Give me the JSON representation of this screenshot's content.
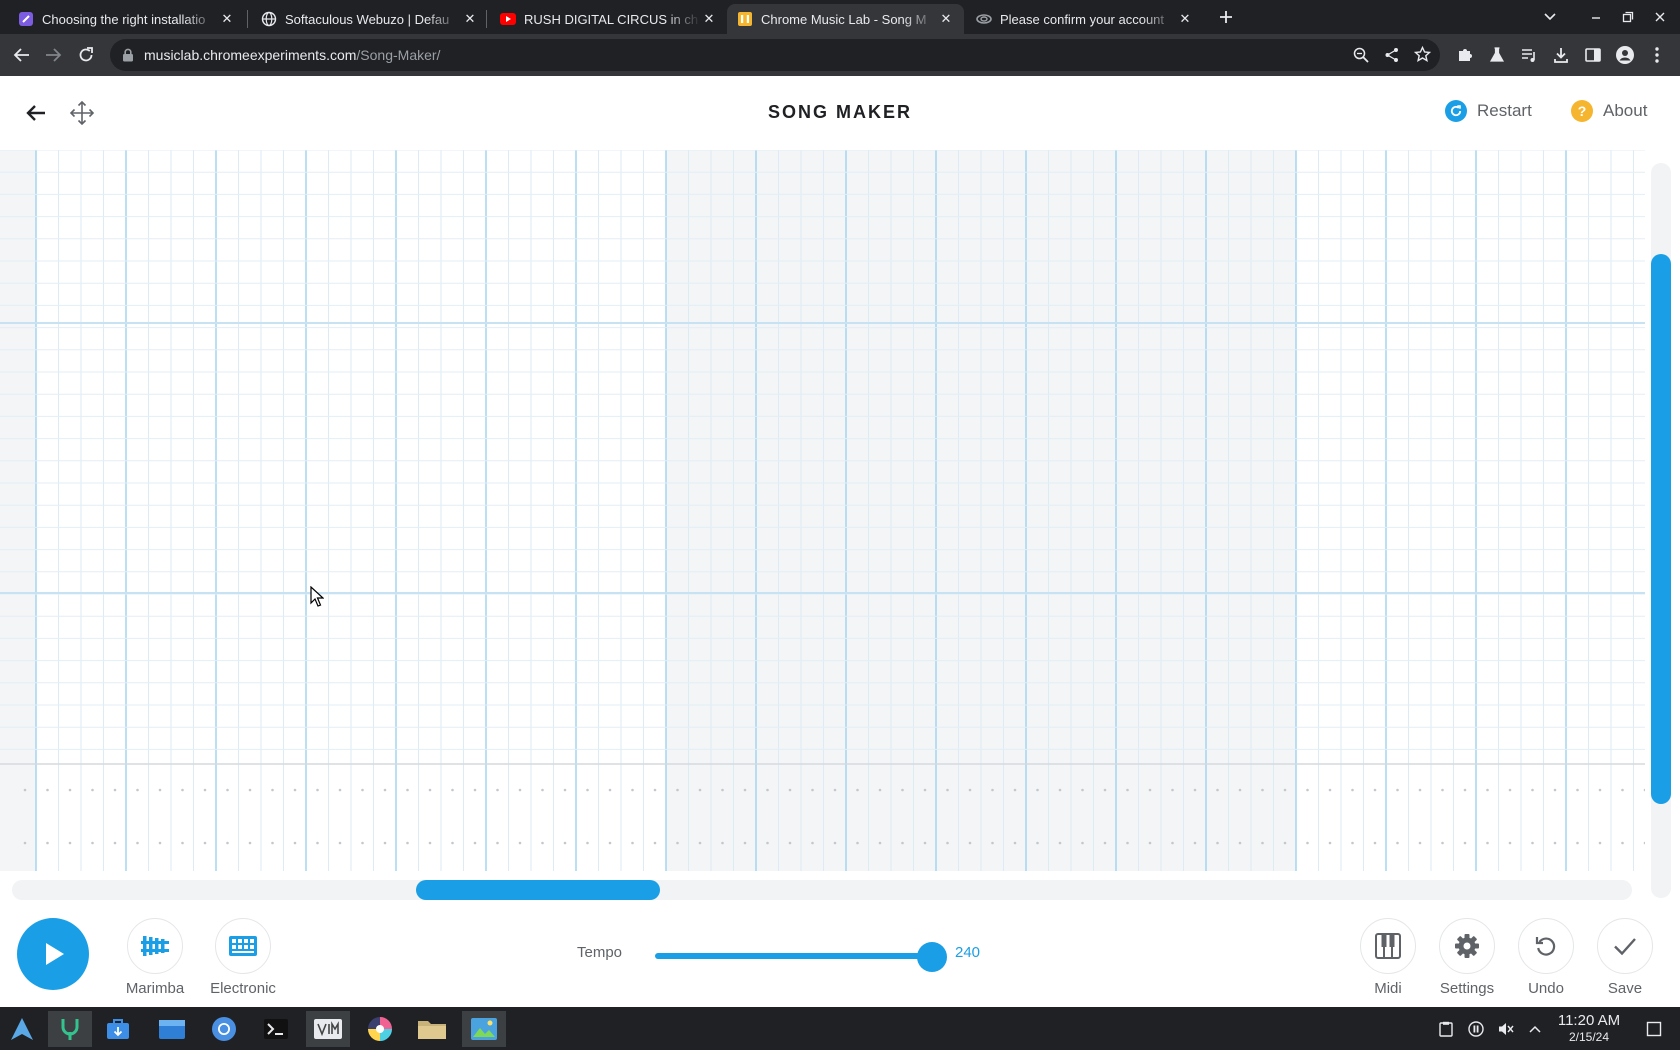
{
  "browser": {
    "tabs": [
      {
        "title": "Choosing the right installatio",
        "favicon": "softaculous-icon",
        "active": false
      },
      {
        "title": "Softaculous Webuzo | Defau",
        "favicon": "globe-icon",
        "active": false
      },
      {
        "title": "RUSH DIGITAL CIRCUS in ch",
        "favicon": "youtube-icon",
        "active": false
      },
      {
        "title": "Chrome Music Lab - Song M",
        "favicon": "music-lab-icon",
        "active": true
      },
      {
        "title": "Please confirm your account",
        "favicon": "link-icon",
        "active": false
      }
    ],
    "url_host": "musiclab.chromeexperiments.com",
    "url_path": "/Song-Maker/"
  },
  "app": {
    "title": "SONG MAKER",
    "restart_label": "Restart",
    "about_label": "About",
    "about_glyph": "?"
  },
  "controls": {
    "play_icon": "play-icon",
    "instrument_label": "Marimba",
    "percussion_label": "Electronic",
    "tempo_label": "Tempo",
    "tempo_value": "240",
    "tempo_fraction": 0.96,
    "midi_label": "Midi",
    "settings_label": "Settings",
    "undo_label": "Undo",
    "save_label": "Save"
  },
  "colors": {
    "accent": "#1a9fe6",
    "restart_icon": "#1a9fe6",
    "about_icon": "#f5b52e"
  },
  "taskbar": {
    "time": "11:20 AM",
    "date": "2/15/24"
  }
}
